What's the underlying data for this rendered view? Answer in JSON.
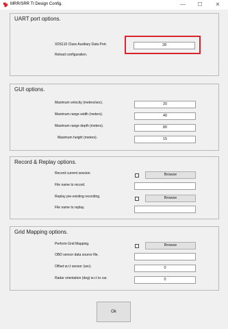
{
  "window": {
    "title": "MRR/SRR TI Design Config.",
    "minimize_glyph": "—",
    "maximize_glyph": "☐",
    "close_glyph": "✕",
    "icon": "ti-logo-icon",
    "icon_color": "#d8232a"
  },
  "uart": {
    "title": "UART port options.",
    "aux_port_label": "XDS110 Class Auxiliary Data Port.",
    "aux_port_value": "28",
    "reload_label": "Reload configuration.",
    "highlight_color": "#d8232a"
  },
  "gui": {
    "title": "GUI options.",
    "fields": [
      {
        "label": "Maximum velocity (meters/sec).",
        "value": "20"
      },
      {
        "label": "Maximum range width (meters).",
        "value": "40"
      },
      {
        "label": "Maximum range depth (meters).",
        "value": "80"
      },
      {
        "label": "Maximum height      (meters).",
        "value": "15"
      }
    ]
  },
  "record": {
    "title": "Record & Replay options.",
    "record_session_label": "Record current session.",
    "record_checked": false,
    "record_browse": "Browse",
    "record_file_label": "File name to record.",
    "record_file_value": "",
    "replay_label": "Replay pre-existing recording.",
    "replay_checked": false,
    "replay_browse": "Browse",
    "replay_file_label": "File name to replay.",
    "replay_file_value": ""
  },
  "grid": {
    "title": "Grid Mapping options.",
    "perform_label": "Perform Grid Mapping.",
    "perform_checked": false,
    "perform_browse": "Browse",
    "obd_label": "OBD sensor data source file.",
    "obd_value": "",
    "offset_label": "Offset w.r.t sensor (sec).",
    "offset_value": "0",
    "orientation_label": "Radar orientation (deg) w.r.t to car.",
    "orientation_value": "0"
  },
  "footer": {
    "ok_label": "Ok"
  }
}
